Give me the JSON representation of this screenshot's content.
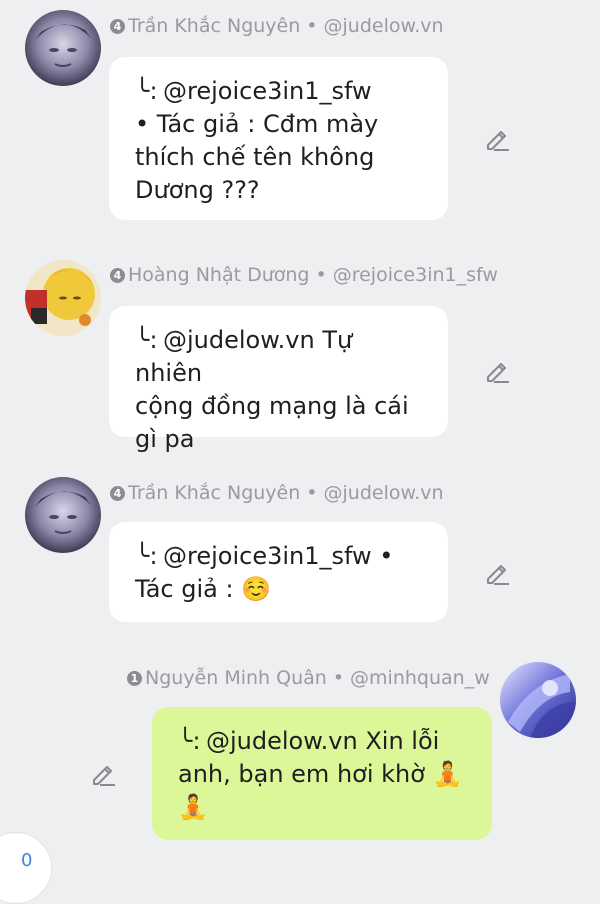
{
  "messages": [
    {
      "level": "4",
      "author": "Trần Khắc Nguyên",
      "handle": "@judelow.vn",
      "reply_marker": "╰:",
      "text_lines": [
        "@rejoice3in1_sfw",
        "• Tác giả : Cđm mày",
        "thích chế tên không",
        "Dương ???"
      ]
    },
    {
      "level": "4",
      "author": "Hoàng Nhật Dương",
      "handle": "@rejoice3in1_sfw",
      "reply_marker": "╰:",
      "text_lines": [
        "@judelow.vn Tự nhiên",
        "cộng đồng mạng là cái",
        "gì pa"
      ]
    },
    {
      "level": "4",
      "author": "Trần Khắc Nguyên",
      "handle": "@judelow.vn",
      "reply_marker": "╰:",
      "text_lines": [
        "@rejoice3in1_sfw •",
        "Tác giả : ☺️"
      ]
    },
    {
      "level": "1",
      "author": "Nguyễn Minh Quân",
      "handle": "@minhquan_w",
      "reply_marker": "╰:",
      "text_lines": [
        "@judelow.vn Xin lỗi",
        "anh, bạn em hơi khờ 🧘",
        "🧘"
      ]
    }
  ],
  "separator": "•",
  "counter": "0",
  "colors": {
    "incoming_bubble": "#ffffff",
    "outgoing_bubble": "#dcf797",
    "background": "#eeeff1",
    "meta_text": "#9b9b9f",
    "counter_text": "#3f86d4"
  },
  "icons": {
    "edit": "pencil-icon"
  }
}
